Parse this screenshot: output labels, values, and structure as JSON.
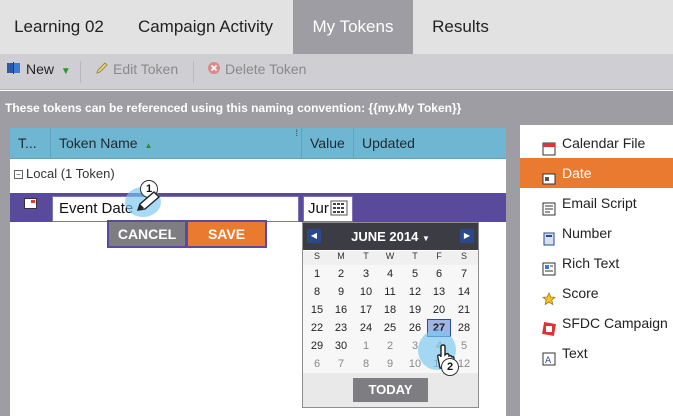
{
  "tabs": [
    {
      "label": "Learning 02"
    },
    {
      "label": "Campaign Activity"
    },
    {
      "label": "My Tokens"
    },
    {
      "label": "Results"
    }
  ],
  "toolbar": {
    "new_label": "New",
    "edit_label": "Edit Token",
    "delete_label": "Delete Token"
  },
  "hint": "These tokens can be referenced using this naming convention: {{my.My Token}}",
  "grid": {
    "columns": [
      "T...",
      "Token Name",
      "Value",
      "Updated"
    ],
    "group_label": "Local (1 Token)",
    "edit_row": {
      "name_value": "Event Date",
      "value_value": "Jur"
    },
    "cancel_label": "CANCEL",
    "save_label": "SAVE"
  },
  "calendar": {
    "title": "JUNE 2014",
    "dow": [
      "S",
      "M",
      "T",
      "W",
      "T",
      "F",
      "S"
    ],
    "weeks": [
      [
        "1",
        "2",
        "3",
        "4",
        "5",
        "6",
        "7"
      ],
      [
        "8",
        "9",
        "10",
        "11",
        "12",
        "13",
        "14"
      ],
      [
        "15",
        "16",
        "17",
        "18",
        "19",
        "20",
        "21"
      ],
      [
        "22",
        "23",
        "24",
        "25",
        "26",
        "27",
        "28"
      ],
      [
        "29",
        "30",
        "1",
        "2",
        "3",
        "4",
        "5"
      ],
      [
        "6",
        "7",
        "8",
        "9",
        "10",
        "11",
        "12"
      ]
    ],
    "selected_day": "27",
    "today_label": "TODAY"
  },
  "callouts": {
    "one": "1",
    "two": "2"
  },
  "right_panel": {
    "items": [
      {
        "label": "Calendar File",
        "icon": "calendar-file-icon"
      },
      {
        "label": "Date",
        "icon": "date-icon"
      },
      {
        "label": "Email Script",
        "icon": "email-script-icon"
      },
      {
        "label": "Number",
        "icon": "number-icon"
      },
      {
        "label": "Rich Text",
        "icon": "rich-text-icon"
      },
      {
        "label": "Score",
        "icon": "score-icon"
      },
      {
        "label": "SFDC Campaign",
        "icon": "sfdc-campaign-icon"
      },
      {
        "label": "Text",
        "icon": "text-icon"
      }
    ],
    "active_index": 1
  },
  "colors": {
    "accent": "#ea7a2f",
    "header_blue": "#6eb6d2",
    "edit_purple": "#5a4a9c",
    "tab_gray": "#9d9da3"
  }
}
